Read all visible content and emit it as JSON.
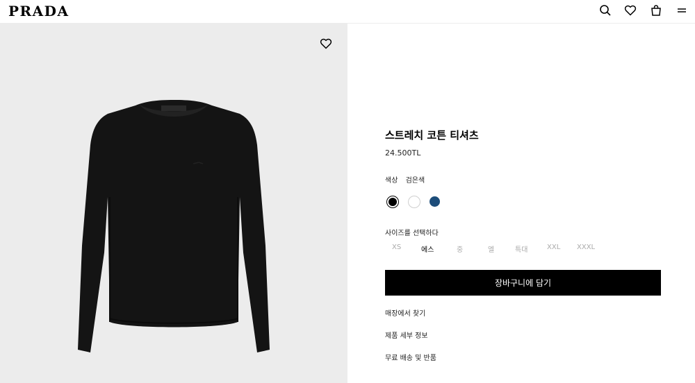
{
  "header": {
    "logo": "PRADA",
    "icons": [
      "search-icon",
      "heart-icon",
      "bag-icon",
      "menu-icon"
    ]
  },
  "gallery": {
    "wishlist_icon": "heart-icon",
    "product_color": "#111111",
    "background": "#ececec"
  },
  "product": {
    "title": "스트레치 코튼 티셔츠",
    "price": "24.500TL",
    "color_label": "색상",
    "color_value": "검은색",
    "swatches": [
      {
        "name": "black",
        "hex": "#000000",
        "selected": true
      },
      {
        "name": "white",
        "hex": "#ffffff",
        "selected": false
      },
      {
        "name": "navy",
        "hex": "#1d4d7a",
        "selected": false
      }
    ],
    "size_label": "사이즈를 선택하다",
    "sizes": [
      "XS",
      "에스",
      "중",
      "엘",
      "특대",
      "XXL",
      "XXXL"
    ],
    "active_size": "에스",
    "cart_button": "장바구니에 담기",
    "links": [
      "매장에서 찾기",
      "제품 세부 정보",
      "무료 배송 및 반품"
    ]
  }
}
